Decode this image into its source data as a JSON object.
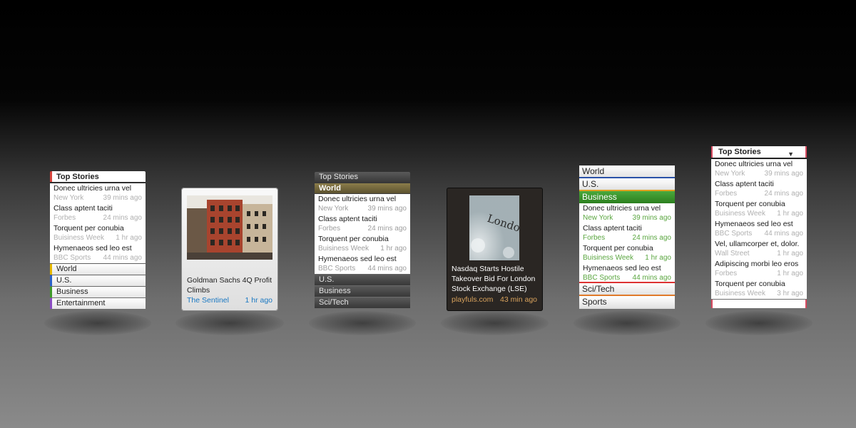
{
  "stories": [
    {
      "title": "Donec ultricies urna vel",
      "source": "New York",
      "time": "39 mins ago"
    },
    {
      "title": "Class aptent taciti",
      "source": "Forbes",
      "time": "24 mins ago"
    },
    {
      "title": "Torquent per conubia",
      "source": "Buisiness Week",
      "time": "1 hr ago"
    },
    {
      "title": "Hymenaeos sed leo est",
      "source": "BBC Sports",
      "time": "44 mins ago"
    }
  ],
  "w1": {
    "header": "Top Stories",
    "categories": [
      "World",
      "U.S.",
      "Business",
      "Entertainment"
    ]
  },
  "w2": {
    "title": "Goldman Sachs 4Q Profit Climbs",
    "source": "The Sentinel",
    "time": "1 hr ago"
  },
  "w3": {
    "header": "Top Stories",
    "active": "World",
    "categories": [
      "U.S.",
      "Business",
      "Sci/Tech"
    ]
  },
  "w4": {
    "title": "Nasdaq Starts Hostile Takeover Bid For London Stock Exchange (LSE)",
    "source": "playfuls.com",
    "time": "43 min ago",
    "image_text": "London STOCK EXCH"
  },
  "w5": {
    "categories_top": [
      "World",
      "U.S."
    ],
    "active": "Business",
    "stories": [
      {
        "title": "Donec ultricies urna vel",
        "source": "New York",
        "time": "39 mins ago"
      },
      {
        "title": "Class aptent taciti",
        "source": "Forbes",
        "time": "24 mins ago"
      },
      {
        "title": "Torquent per conubia",
        "source": "Buisiness Week",
        "time": "1 hr ago"
      },
      {
        "title": "Hymenaeos sed leo est",
        "source": "BBC Sports",
        "time": "44 mins ago"
      }
    ],
    "categories_bottom": [
      "Sci/Tech",
      "Sports"
    ]
  },
  "w6": {
    "header": "Top Stories",
    "stories": [
      {
        "title": "Donec ultricies urna vel",
        "source": "New York",
        "time": "39 mins ago"
      },
      {
        "title": "Class aptent taciti",
        "source": "Forbes",
        "time": "24 mins ago"
      },
      {
        "title": "Torquent per conubia",
        "source": "Buisiness Week",
        "time": "1 hr ago"
      },
      {
        "title": "Hymenaeos sed leo est",
        "source": "BBC Sports",
        "time": "44 mins ago"
      },
      {
        "title": "Vel, ullamcorper et, dolor.",
        "source": "Wall Street",
        "time": "1 hr ago"
      },
      {
        "title": "Adipiscing morbi leo eros",
        "source": "Forbes",
        "time": "1 hr ago"
      },
      {
        "title": "Torquent per conubia",
        "source": "Buisiness Week",
        "time": "3 hr ago"
      }
    ]
  }
}
